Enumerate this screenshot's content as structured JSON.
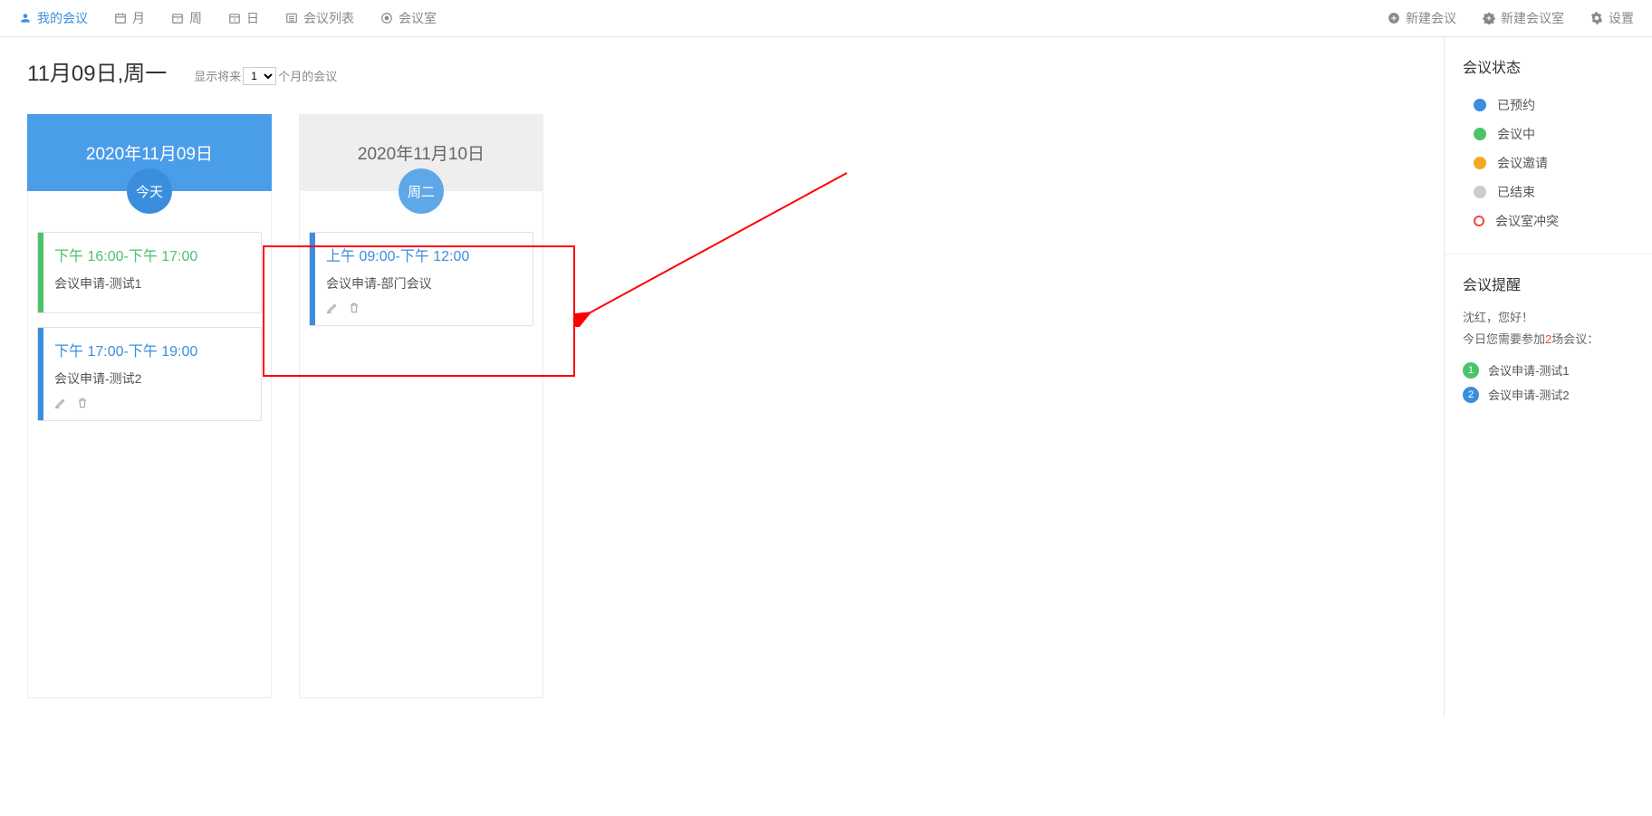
{
  "toolbar": {
    "left": [
      {
        "label": "我的会议",
        "active": true,
        "icon": "user"
      },
      {
        "label": "月",
        "active": false,
        "icon": "calendar"
      },
      {
        "label": "周",
        "active": false,
        "icon": "calendar"
      },
      {
        "label": "日",
        "active": false,
        "icon": "calendar"
      },
      {
        "label": "会议列表",
        "active": false,
        "icon": "list"
      },
      {
        "label": "会议室",
        "active": false,
        "icon": "building"
      }
    ],
    "right": [
      {
        "label": "新建会议",
        "icon": "plus"
      },
      {
        "label": "新建会议室",
        "icon": "plus"
      },
      {
        "label": "设置",
        "icon": "gear"
      }
    ]
  },
  "header": {
    "date_title": "11月09日,周一",
    "filter_prefix": "显示将来",
    "filter_value": "1",
    "filter_suffix": "个月的会议"
  },
  "days": [
    {
      "date": "2020年11月09日",
      "badge": "今天",
      "is_today": true,
      "meetings": [
        {
          "time": "下午 16:00-下午 17:00",
          "title": "会议申请-测试1",
          "status": "active",
          "show_actions": false
        },
        {
          "time": "下午 17:00-下午 19:00",
          "title": "会议申请-测试2",
          "status": "reserved",
          "show_actions": true
        }
      ]
    },
    {
      "date": "2020年11月10日",
      "badge": "周二",
      "is_today": false,
      "meetings": [
        {
          "time": "上午 09:00-下午 12:00",
          "title": "会议申请-部门会议",
          "status": "reserved",
          "show_actions": true
        }
      ]
    }
  ],
  "sidebar": {
    "status_title": "会议状态",
    "statuses": [
      {
        "label": "已预约",
        "class": "dot-reserved"
      },
      {
        "label": "会议中",
        "class": "dot-active"
      },
      {
        "label": "会议邀请",
        "class": "dot-invite"
      },
      {
        "label": "已结束",
        "class": "dot-ended"
      },
      {
        "label": "会议室冲突",
        "class": "dot-conflict"
      }
    ],
    "reminder_title": "会议提醒",
    "greeting": "沈红，您好！",
    "reminder_prefix": "今日您需要参加",
    "reminder_count": "2",
    "reminder_suffix": "场会议：",
    "reminders": [
      {
        "num": "1",
        "label": "会议申请-测试1",
        "badge_class": "badge-1"
      },
      {
        "num": "2",
        "label": "会议申请-测试2",
        "badge_class": "badge-2"
      }
    ]
  }
}
